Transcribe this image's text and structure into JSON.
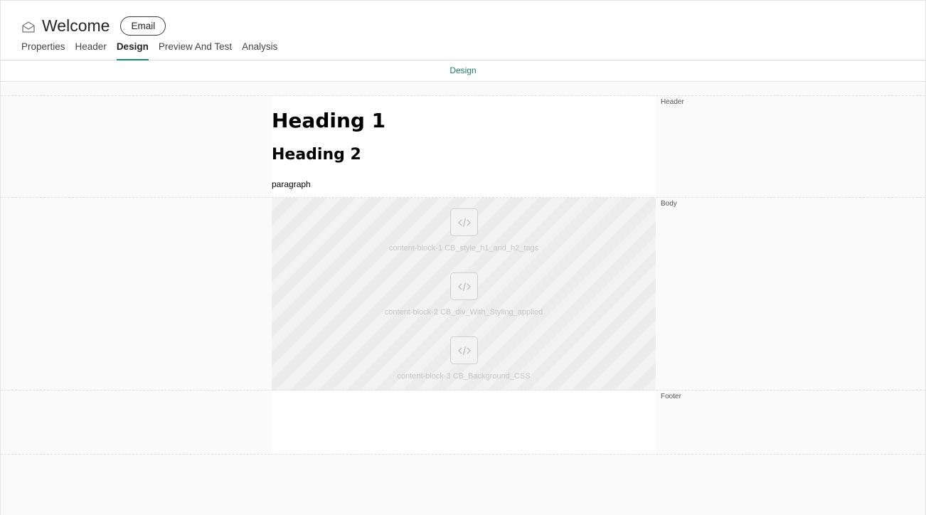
{
  "header": {
    "title": "Welcome",
    "type_badge": "Email",
    "icon": "envelope-open-icon"
  },
  "tabs": [
    {
      "label": "Properties",
      "active": false
    },
    {
      "label": "Header",
      "active": false
    },
    {
      "label": "Design",
      "active": true
    },
    {
      "label": "Preview And Test",
      "active": false
    },
    {
      "label": "Analysis",
      "active": false
    }
  ],
  "subbar": {
    "label": "Design"
  },
  "sections": {
    "header": {
      "label": "Header",
      "heading1": "Heading 1",
      "heading2": "Heading 2",
      "paragraph": "paragraph"
    },
    "body": {
      "label": "Body",
      "blocks": [
        {
          "label": "content-block-1 CB_style_h1_and_h2_tags",
          "icon": "code-icon"
        },
        {
          "label": "content-block-2 CB_div_With_Styling_applied",
          "icon": "code-icon"
        },
        {
          "label": "content-block-3 CB_Background_CSS",
          "icon": "code-icon"
        }
      ]
    },
    "footer": {
      "label": "Footer"
    }
  },
  "colors": {
    "accent": "#1a8a74",
    "accent_text": "#1e7a66",
    "workspace_bg": "#fafafa",
    "body_placeholder_bg": "#ececec"
  }
}
